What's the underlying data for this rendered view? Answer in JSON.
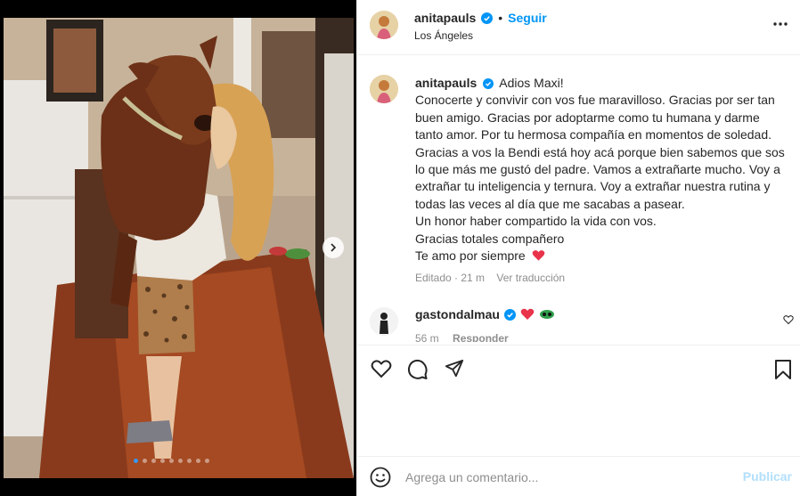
{
  "post": {
    "username": "anitapauls",
    "follow_label": "Seguir",
    "separator": "•",
    "location": "Los Ángeles",
    "verified_color": "#0095f6",
    "accent_color": "#0095f6"
  },
  "caption": {
    "username": "anitapauls",
    "lines": [
      "Adios Maxi!",
      "Conocerte y convivir con vos fue maravilloso. Gracias por ser tan buen amigo. Gracias por adoptarme como tu humana y darme tanto amor. Por tu hermosa compañía en momentos de soledad. Gracias a vos la Bendi está hoy acá porque bien sabemos que sos lo que más me gustó del padre. Vamos a extrañarte mucho. Voy a extrañar tu inteligencia y ternura. Voy a extrañar nuestra rutina y todas las veces al día que me sacabas a pasear.",
      "Un honor haber compartido la vida con vos.",
      "Gracias totales compañero",
      "Te amo por siempre"
    ],
    "edited": "Editado · 21 m",
    "translate": "Ver traducción"
  },
  "comment": {
    "username": "gastondalmau",
    "time": "56 m",
    "reply": "Responder"
  },
  "carousel": {
    "slide_count": 9,
    "active_index": 0
  },
  "composer": {
    "placeholder": "Agrega un comentario...",
    "publish": "Publicar"
  },
  "icons": {
    "more": "more-options-icon",
    "like": "heart-icon",
    "comment": "comment-icon",
    "share": "share-icon",
    "save": "bookmark-icon",
    "emoji": "emoji-icon",
    "next": "chevron-right-icon"
  }
}
